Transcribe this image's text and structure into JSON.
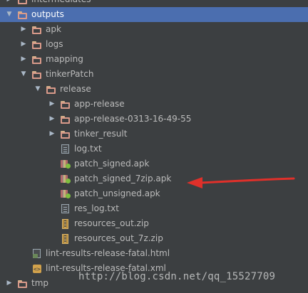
{
  "tree": [
    {
      "label": "intermediates",
      "depth": 1,
      "type": "folder",
      "expanded": false
    },
    {
      "label": "outputs",
      "depth": 1,
      "type": "folder",
      "expanded": true,
      "selected": true
    },
    {
      "label": "apk",
      "depth": 2,
      "type": "folder",
      "expanded": false
    },
    {
      "label": "logs",
      "depth": 2,
      "type": "folder",
      "expanded": false
    },
    {
      "label": "mapping",
      "depth": 2,
      "type": "folder",
      "expanded": false
    },
    {
      "label": "tinkerPatch",
      "depth": 2,
      "type": "folder",
      "expanded": true
    },
    {
      "label": "release",
      "depth": 3,
      "type": "folder",
      "expanded": true
    },
    {
      "label": "app-release",
      "depth": 4,
      "type": "folder",
      "expanded": false
    },
    {
      "label": "app-release-0313-16-49-55",
      "depth": 4,
      "type": "folder",
      "expanded": false
    },
    {
      "label": "tinker_result",
      "depth": 4,
      "type": "folder",
      "expanded": false
    },
    {
      "label": "log.txt",
      "depth": 4,
      "type": "txt"
    },
    {
      "label": "patch_signed.apk",
      "depth": 4,
      "type": "apk"
    },
    {
      "label": "patch_signed_7zip.apk",
      "depth": 4,
      "type": "apk"
    },
    {
      "label": "patch_unsigned.apk",
      "depth": 4,
      "type": "apk"
    },
    {
      "label": "res_log.txt",
      "depth": 4,
      "type": "txt"
    },
    {
      "label": "resources_out.zip",
      "depth": 4,
      "type": "zip"
    },
    {
      "label": "resources_out_7z.zip",
      "depth": 4,
      "type": "zip"
    },
    {
      "label": "lint-results-release-fatal.html",
      "depth": 2,
      "type": "html"
    },
    {
      "label": "lint-results-release-fatal.xml",
      "depth": 2,
      "type": "xml"
    },
    {
      "label": "tmp",
      "depth": 1,
      "type": "folder",
      "expanded": false
    }
  ],
  "watermark": "http://blog.csdn.net/qq_15527709",
  "colors": {
    "background": "#3c3f41",
    "selection": "#4b6eaf",
    "annotation_arrow": "#e0302a"
  }
}
